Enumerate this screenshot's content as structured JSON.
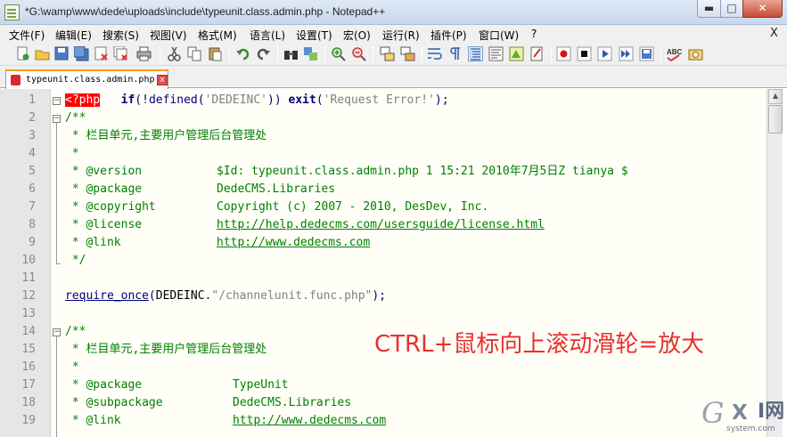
{
  "window": {
    "title": "*G:\\wamp\\www\\dede\\uploads\\include\\typeunit.class.admin.php - Notepad++",
    "controls": {
      "minimize": "▬",
      "maximize": "□",
      "close": "✕"
    }
  },
  "menu": {
    "items": [
      "文件(F)",
      "编辑(E)",
      "搜索(S)",
      "视图(V)",
      "格式(M)",
      "语言(L)",
      "设置(T)",
      "宏(O)",
      "运行(R)",
      "插件(P)",
      "窗口(W)",
      "?"
    ],
    "close_doc": "X"
  },
  "toolbar": {
    "icons": [
      "new-file-icon",
      "open-file-icon",
      "save-icon",
      "save-all-icon",
      "close-icon",
      "close-all-icon",
      "print-icon",
      "cut-icon",
      "copy-icon",
      "paste-icon",
      "undo-icon",
      "redo-icon",
      "find-icon",
      "replace-icon",
      "zoom-in-icon",
      "zoom-out-icon",
      "sync-vertical-icon",
      "sync-horizontal-icon",
      "word-wrap-icon",
      "show-all-chars-icon",
      "indent-guide-icon",
      "user-lang-icon",
      "doc-map-icon",
      "function-list-icon",
      "record-macro-icon",
      "stop-macro-icon",
      "play-macro-icon",
      "run-macro-multiple-icon",
      "save-macro-icon",
      "spell-check-icon",
      "spell-check-options-icon"
    ],
    "spellcheck_label": "ABC"
  },
  "tab": {
    "label": "typeunit.class.admin.php",
    "close": "x"
  },
  "editor": {
    "lines": [
      {
        "n": "1"
      },
      {
        "n": "2"
      },
      {
        "n": "3"
      },
      {
        "n": "4"
      },
      {
        "n": "5"
      },
      {
        "n": "6"
      },
      {
        "n": "7"
      },
      {
        "n": "8"
      },
      {
        "n": "9"
      },
      {
        "n": "10"
      },
      {
        "n": "11"
      },
      {
        "n": "12"
      },
      {
        "n": "13"
      },
      {
        "n": "14"
      },
      {
        "n": "15"
      },
      {
        "n": "16"
      },
      {
        "n": "17"
      },
      {
        "n": "18"
      },
      {
        "n": "19"
      }
    ],
    "code": {
      "l1": {
        "php": "<?php",
        "if": "if",
        "p1": "(",
        "not": "!",
        "defined": "defined",
        "p2": "(",
        "str": "'DEDEINC'",
        "p3": "))",
        "exit": "exit",
        "p4": "(",
        "msg": "'Request Error!'",
        "p5": ");"
      },
      "l2": "/**",
      "l3": " * 栏目单元,主要用户管理后台管理处",
      "l4": " *",
      "l5": {
        "tag": " * @version",
        "val": "$Id: typeunit.class.admin.php 1 15:21 2010年7月5日Z tianya $"
      },
      "l6": {
        "tag": " * @package",
        "val": "DedeCMS.Libraries"
      },
      "l7": {
        "tag": " * @copyright",
        "val": "Copyright (c) 2007 - 2010, DesDev, Inc."
      },
      "l8": {
        "tag": " * @license",
        "val": "http://help.dedecms.com/usersguide/license.html"
      },
      "l9": {
        "tag": " * @link",
        "val": "http://www.dedecms.com"
      },
      "l10": " */",
      "l12": {
        "fn": "require_once",
        "p1": "(",
        "const": "DEDEINC",
        "dot": ".",
        "str": "\"/channelunit.func.php\"",
        "p2": ");"
      },
      "l14": "/**",
      "l15": " * 栏目单元,主要用户管理后台管理处",
      "l16": " *",
      "l17": {
        "tag": " * @package",
        "val": "TypeUnit"
      },
      "l18": {
        "tag": " * @subpackage",
        "val": "DedeCMS.Libraries"
      },
      "l19": {
        "tag": " * @link",
        "val": "http://www.dedecms.com"
      }
    }
  },
  "annotation": "CTRL+鼠标向上滚动滑轮=放大",
  "watermark": {
    "g": "G",
    "x": "X",
    "cn": "I网",
    "domain": "system.com"
  },
  "colors": {
    "keyword": "#000080",
    "string": "#808080",
    "comment": "#008000",
    "php_tag_bg": "#ff0000",
    "annotation": "#e6312e"
  }
}
